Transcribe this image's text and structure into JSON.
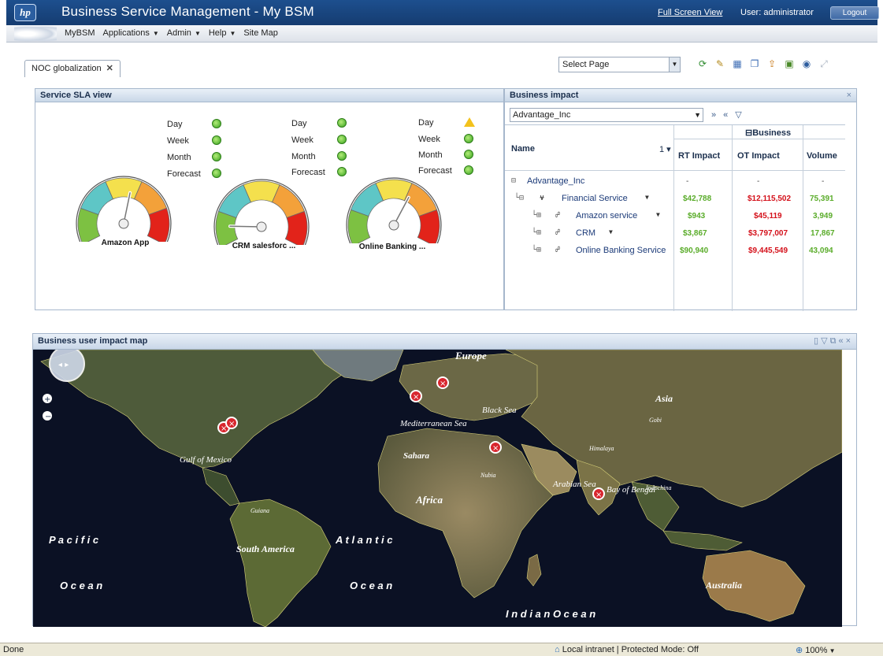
{
  "app": {
    "logo": "hp",
    "title": "Business Service Management   - My BSM",
    "full_screen_link": "Full Screen View",
    "user_label": "User: administrator",
    "logout_label": "Logout"
  },
  "menu": {
    "items": [
      {
        "label": "MyBSM"
      },
      {
        "label": "Applications"
      },
      {
        "label": "Admin"
      },
      {
        "label": "Help"
      },
      {
        "label": "Site Map"
      }
    ]
  },
  "tabs": [
    {
      "label": "NOC globalization",
      "close": "✕"
    }
  ],
  "page_select": {
    "value": "Select Page"
  },
  "toolbar_icons": [
    "refresh-icon",
    "edit-icon",
    "layout-icon",
    "new-page-icon",
    "share-icon",
    "image-icon",
    "settings-icon",
    "maximize-icon"
  ],
  "sla_panel": {
    "title": "Service SLA view",
    "period_labels": [
      "Day",
      "Week",
      "Month",
      "Forecast"
    ],
    "gauges": [
      {
        "name": "Amazon App",
        "level": 0.55,
        "statuses": [
          "ok",
          "ok",
          "ok",
          "ok"
        ]
      },
      {
        "name": "CRM salesforc ...",
        "level": 0.12,
        "statuses": [
          "ok",
          "ok",
          "ok",
          "ok"
        ]
      },
      {
        "name": "Online Banking ...",
        "level": 0.62,
        "statuses": [
          "warning",
          "ok",
          "ok",
          "ok"
        ]
      }
    ]
  },
  "business_impact": {
    "title": "Business impact",
    "close": "×",
    "selected_entity": "Advantage_Inc",
    "group_header": "Business",
    "columns": {
      "name": "Name",
      "sort": "1 ▾",
      "rt": "RT Impact",
      "ot": "OT Impact",
      "volume": "Volume"
    },
    "rows": [
      {
        "name": "Advantage_Inc",
        "rt": "-",
        "ot": "-",
        "volume": "-"
      },
      {
        "name": "Financial Service",
        "rt": "$42,788",
        "ot": "$12,115,502",
        "volume": "75,391"
      },
      {
        "name": "Amazon service",
        "rt": "$943",
        "ot": "$45,119",
        "volume": "3,949"
      },
      {
        "name": "CRM",
        "rt": "$3,867",
        "ot": "$3,797,007",
        "volume": "17,867"
      },
      {
        "name": "Online Banking Service",
        "rt": "$90,940",
        "ot": "$9,445,549",
        "volume": "43,094"
      }
    ]
  },
  "map_panel": {
    "title": "Business user impact map",
    "labels": {
      "europe": "Europe",
      "asia": "Asia",
      "gobi": "Gobi",
      "black_sea": "Black Sea",
      "med_sea": "Mediterranean Sea",
      "sahara": "Sahara",
      "nubia": "Nubia",
      "arabian_sea": "Arabian Sea",
      "bay_bengal": "Bay of Bengal",
      "himalaya": "Himalaya",
      "indochina": "Indochina",
      "gulf_mexico": "Gulf of Mexico",
      "guiana": "Guiana",
      "africa": "Africa",
      "south_america": "South America",
      "pacific": "P a c i f i c",
      "atlantic": "A t l a n t i c",
      "ocean_left": "O c e a n",
      "ocean_mid": "O c e a n",
      "indian_ocean": "I n d i a n   O c e a n",
      "australia": "Australia"
    },
    "markers": 6
  },
  "statusbar": {
    "left": "Done",
    "zone": "Local intranet | Protected Mode: Off",
    "zoom": "100%"
  }
}
